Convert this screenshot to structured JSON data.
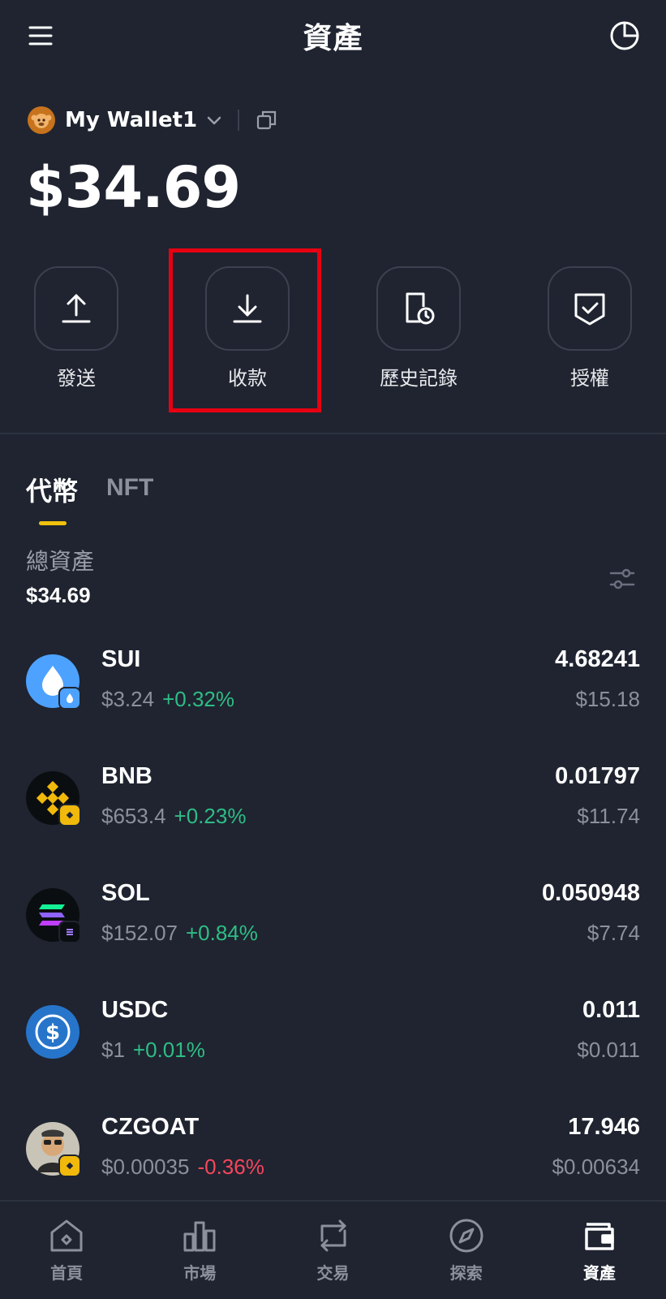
{
  "header": {
    "title": "資產"
  },
  "wallet": {
    "name": "My Wallet1",
    "balance": "$34.69"
  },
  "actions": [
    {
      "label": "發送",
      "icon": "send-icon"
    },
    {
      "label": "收款",
      "icon": "receive-icon"
    },
    {
      "label": "歷史記錄",
      "icon": "history-icon"
    },
    {
      "label": "授權",
      "icon": "authorize-icon"
    }
  ],
  "tabs": {
    "tokens": "代幣",
    "nft": "NFT"
  },
  "summary": {
    "label": "總資產",
    "value": "$34.69"
  },
  "tokens": [
    {
      "symbol": "SUI",
      "price": "$3.24",
      "change": "+0.32%",
      "amount": "4.68241",
      "value": "$15.18"
    },
    {
      "symbol": "BNB",
      "price": "$653.4",
      "change": "+0.23%",
      "amount": "0.01797",
      "value": "$11.74"
    },
    {
      "symbol": "SOL",
      "price": "$152.07",
      "change": "+0.84%",
      "amount": "0.050948",
      "value": "$7.74"
    },
    {
      "symbol": "USDC",
      "price": "$1",
      "change": "+0.01%",
      "amount": "0.011",
      "value": "$0.011"
    },
    {
      "symbol": "CZGOAT",
      "price": "$0.00035",
      "change": "-0.36%",
      "amount": "17.946",
      "value": "$0.00634"
    }
  ],
  "nav": [
    {
      "label": "首頁",
      "icon": "home-icon"
    },
    {
      "label": "市場",
      "icon": "market-icon"
    },
    {
      "label": "交易",
      "icon": "trade-icon"
    },
    {
      "label": "探索",
      "icon": "explore-icon"
    },
    {
      "label": "資產",
      "icon": "wallet-icon",
      "active": true
    }
  ],
  "colors": {
    "background": "#1f2430",
    "accent": "#f0c20e",
    "positive": "#2ebd85",
    "negative": "#f6465d",
    "highlight": "#e60012"
  }
}
